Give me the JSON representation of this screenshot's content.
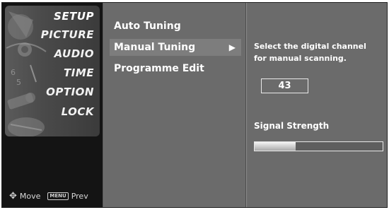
{
  "left_menu": {
    "items": [
      {
        "label": "SETUP",
        "active": true
      },
      {
        "label": "PICTURE"
      },
      {
        "label": "AUDIO"
      },
      {
        "label": "TIME"
      },
      {
        "label": "OPTION"
      },
      {
        "label": "LOCK"
      }
    ],
    "hint_move": "Move",
    "hint_menu_key": "MENU",
    "hint_prev": "Prev"
  },
  "submenu": {
    "items": [
      {
        "label": "Auto Tuning"
      },
      {
        "label": "Manual Tuning",
        "selected": true
      },
      {
        "label": "Programme Edit"
      }
    ],
    "arrow": "▶"
  },
  "detail": {
    "instruction": "Select the digital channel for manual scanning.",
    "channel_value": "43",
    "signal_label": "Signal Strength",
    "signal_level_fraction": 0.32
  },
  "colors": {
    "panel_bg": "#6b6b6b",
    "left_bg": "#141414",
    "selected_bg": "#7d7d7d",
    "text": "#ffffff"
  },
  "icons": {
    "move": "four-way-arrow-icon",
    "menu_key": "menu-key-icon",
    "submenu_arrow": "right-triangle-icon"
  }
}
